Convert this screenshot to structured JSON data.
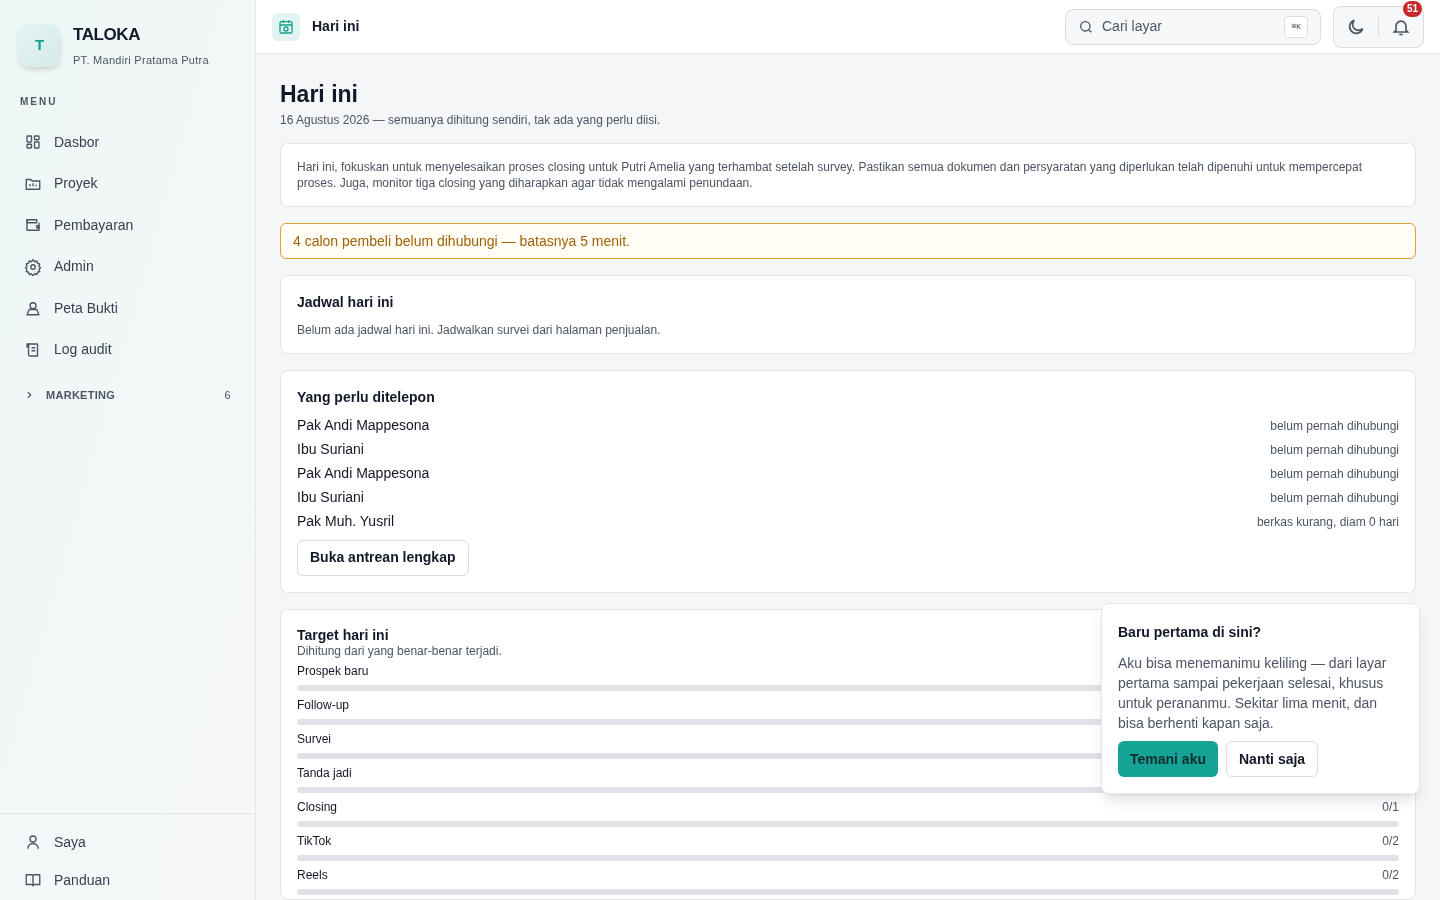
{
  "brand": {
    "logo_letter": "T",
    "name": "TALOKA",
    "company": "PT. Mandiri Pratama Putra"
  },
  "sidebar": {
    "section_label": "MENU",
    "items": [
      {
        "label": "Dasbor"
      },
      {
        "label": "Proyek"
      },
      {
        "label": "Pembayaran"
      },
      {
        "label": "Admin"
      },
      {
        "label": "Peta Bukti"
      },
      {
        "label": "Log audit"
      }
    ],
    "group": {
      "label": "MARKETING",
      "count": "6",
      "expanded": false
    },
    "footer_items": [
      {
        "label": "Saya"
      },
      {
        "label": "Panduan"
      }
    ]
  },
  "topbar": {
    "title": "Hari ini",
    "search": {
      "placeholder": "Cari layar",
      "shortcut": "⌘K"
    },
    "notification_count": "51"
  },
  "page": {
    "title": "Hari ini",
    "subtitle": "16 Agustus 2026 — semuanya dihitung sendiri, tak ada yang perlu diisi.",
    "summary": "Hari ini, fokuskan untuk menyelesaikan proses closing untuk Putri Amelia yang terhambat setelah survey. Pastikan semua dokumen dan persyaratan yang diperlukan telah dipenuhi untuk mempercepat proses. Juga, monitor tiga closing yang diharapkan agar tidak mengalami penundaan.",
    "alert": "4 calon pembeli belum dihubungi — batasnya 5 menit.",
    "schedule": {
      "title": "Jadwal hari ini",
      "empty": "Belum ada jadwal hari ini. Jadwalkan survei dari halaman penjualan."
    },
    "calls": {
      "title": "Yang perlu ditelepon",
      "rows": [
        {
          "name": "Pak Andi Mappesona",
          "status": "belum pernah dihubungi"
        },
        {
          "name": "Ibu Suriani",
          "status": "belum pernah dihubungi"
        },
        {
          "name": "Pak Andi Mappesona",
          "status": "belum pernah dihubungi"
        },
        {
          "name": "Ibu Suriani",
          "status": "belum pernah dihubungi"
        },
        {
          "name": "Pak Muh. Yusril",
          "status": "berkas kurang, diam 0 hari"
        }
      ],
      "button": "Buka antrean lengkap"
    },
    "targets": {
      "title": "Target hari ini",
      "subtitle": "Dihitung dari yang benar-benar terjadi.",
      "items": [
        {
          "label": "Prospek baru",
          "level": 0
        },
        {
          "label": "Follow-up",
          "level": 0
        },
        {
          "label": "Survei",
          "level": 0
        },
        {
          "label": "Tanda jadi",
          "level": 0
        },
        {
          "label": "Closing",
          "level": 0,
          "reading": "0/1"
        },
        {
          "label": "TikTok",
          "level": 0,
          "reading": "0/2"
        },
        {
          "label": "Reels",
          "level": 0,
          "reading": "0/2"
        }
      ]
    }
  },
  "onboarding": {
    "title": "Baru pertama di sini?",
    "body": "Aku bisa menemanimu keliling — dari layar pertama sampai pekerjaan selesai, khusus untuk perananmu. Sekitar lima menit, dan bisa berhenti kapan saja.",
    "primary": "Temani aku",
    "secondary": "Nanti saja"
  }
}
